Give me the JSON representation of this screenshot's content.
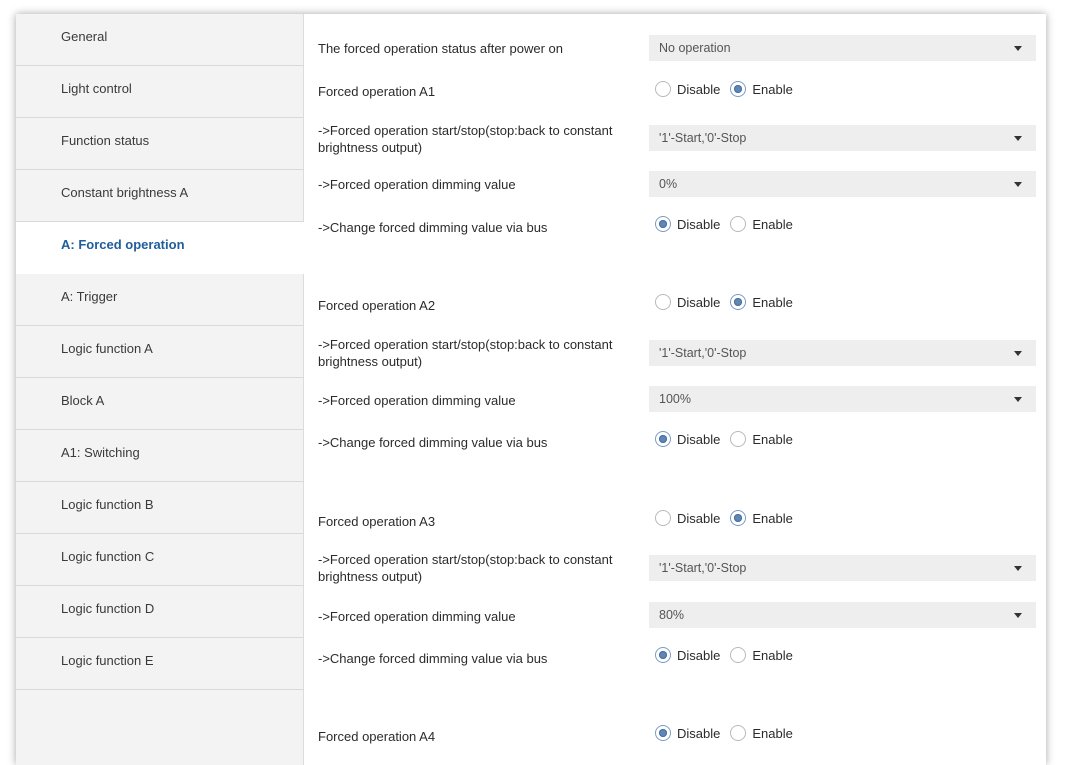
{
  "sidebar": {
    "items": [
      {
        "label": "General"
      },
      {
        "label": "Light control"
      },
      {
        "label": "Function status"
      },
      {
        "label": "Constant brightness A"
      },
      {
        "label": "A: Forced operation",
        "active": true
      },
      {
        "label": "A: Trigger"
      },
      {
        "label": "Logic function A"
      },
      {
        "label": "Block A"
      },
      {
        "label": "A1: Switching"
      },
      {
        "label": "Logic function B"
      },
      {
        "label": "Logic function C"
      },
      {
        "label": "Logic function D"
      },
      {
        "label": "Logic function E"
      }
    ]
  },
  "options": {
    "disable": "Disable",
    "enable": "Enable"
  },
  "power_on": {
    "label": "The forced operation status after power on",
    "value": "No operation"
  },
  "groups": [
    {
      "label": "Forced operation A1",
      "state": "Enable",
      "start_stop_label": "->Forced operation start/stop(stop:back to constant brightness output)",
      "start_stop_value": "'1'-Start,'0'-Stop",
      "dimming_label": "->Forced operation dimming value",
      "dimming_value": "0%",
      "bus_label": "->Change forced dimming value via bus",
      "bus_state": "Disable"
    },
    {
      "label": "Forced operation A2",
      "state": "Enable",
      "start_stop_label": "->Forced operation start/stop(stop:back to constant brightness output)",
      "start_stop_value": "'1'-Start,'0'-Stop",
      "dimming_label": "->Forced operation dimming value",
      "dimming_value": "100%",
      "bus_label": "->Change forced dimming value via bus",
      "bus_state": "Disable"
    },
    {
      "label": "Forced operation A3",
      "state": "Enable",
      "start_stop_label": "->Forced operation start/stop(stop:back to constant brightness output)",
      "start_stop_value": "'1'-Start,'0'-Stop",
      "dimming_label": "->Forced operation dimming value",
      "dimming_value": "80%",
      "bus_label": "->Change forced dimming value via bus",
      "bus_state": "Disable"
    },
    {
      "label": "Forced operation A4",
      "state": "Disable"
    }
  ]
}
